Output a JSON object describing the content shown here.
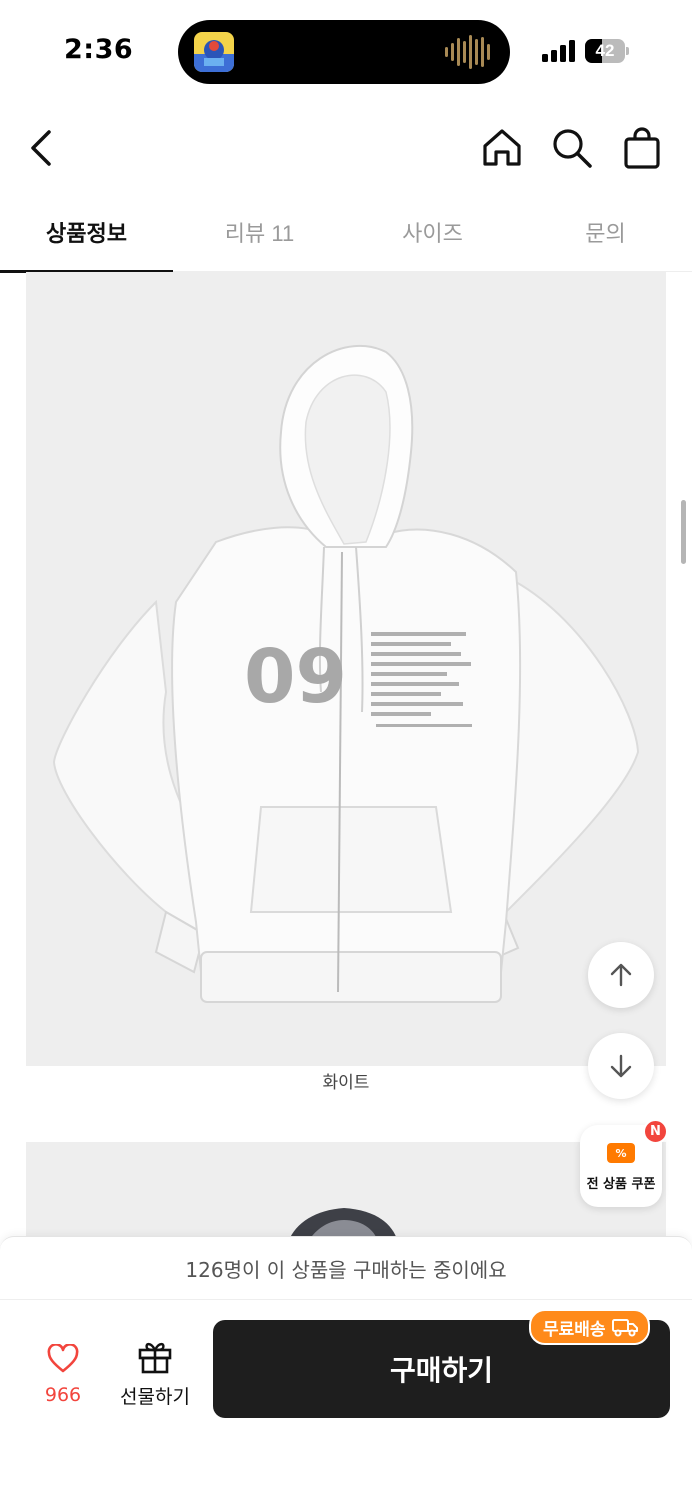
{
  "status_bar": {
    "time": "2:36",
    "battery": "42",
    "battery_level": 0.42
  },
  "nav": {
    "back_icon": "chevron-left-icon",
    "home_icon": "home-icon",
    "search_icon": "search-icon",
    "bag_icon": "shopping-bag-icon"
  },
  "tabs": [
    {
      "label": "상품정보",
      "active": true
    },
    {
      "label": "리뷰 11",
      "active": false
    },
    {
      "label": "사이즈",
      "active": false
    },
    {
      "label": "문의",
      "active": false
    }
  ],
  "product": {
    "print_number": "09",
    "caption": "화이트"
  },
  "floating": {
    "scroll_up_icon": "arrow-up-icon",
    "scroll_down_icon": "arrow-down-icon",
    "coupon_label": "전 상품 쿠폰",
    "coupon_badge": "N"
  },
  "bottom": {
    "buyers_text": "126명이 이 상품을 구매하는 중이에요",
    "like_count": "966",
    "gift_label": "선물하기",
    "buy_label": "구매하기",
    "free_shipping_label": "무료배송"
  },
  "colors": {
    "accent_red": "#f2453d",
    "shipping_orange": "#ff8a1a",
    "buy_button": "#1e1e1e"
  }
}
